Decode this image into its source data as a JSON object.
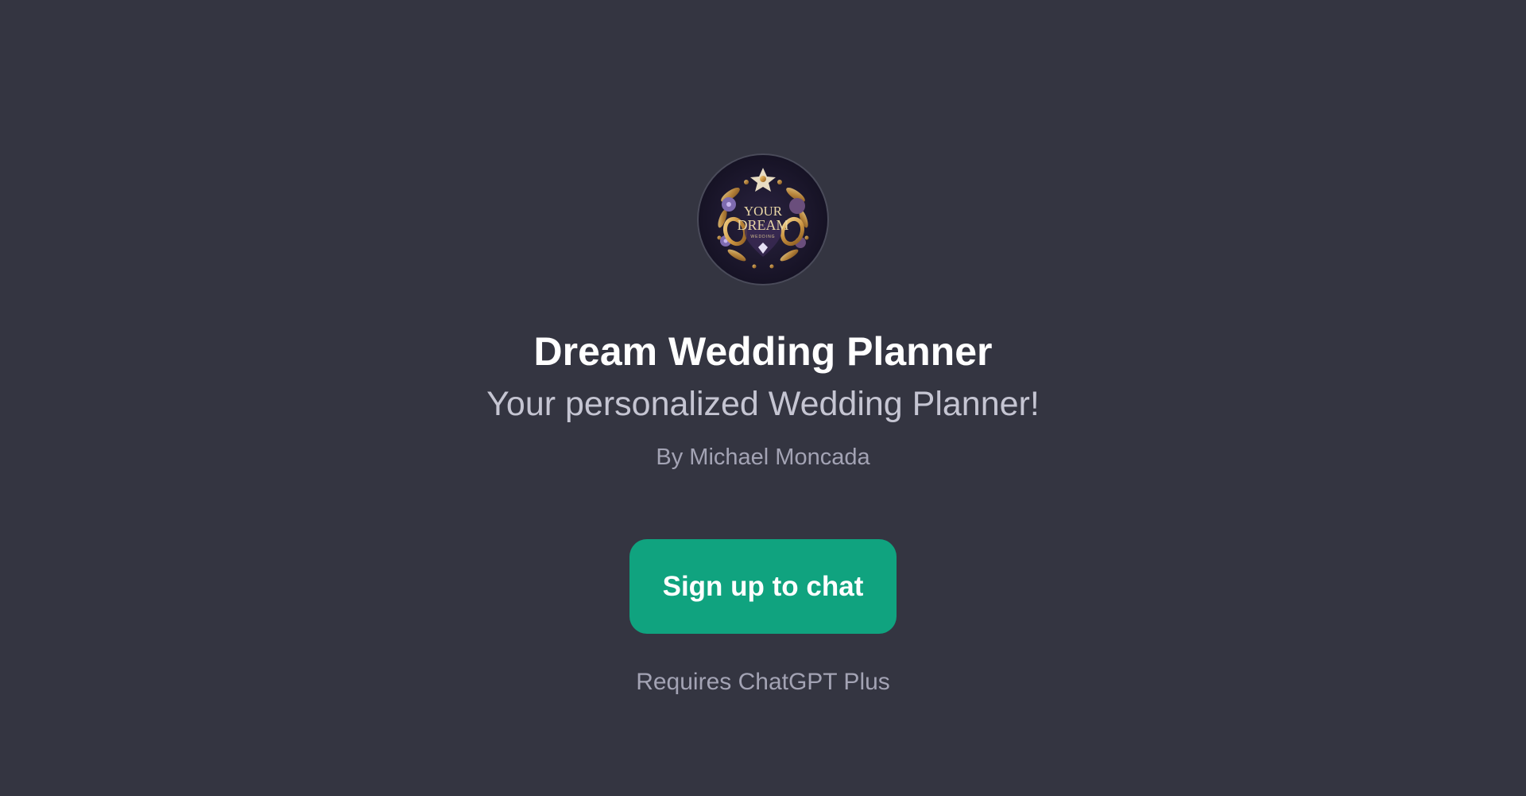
{
  "gpt": {
    "avatar_icon": "wedding-logo-icon",
    "avatar_text_line1": "YOUR",
    "avatar_text_line2": "DREAM",
    "avatar_text_line3": "WEDDING",
    "title": "Dream Wedding Planner",
    "subtitle": "Your personalized Wedding Planner!",
    "author": "By Michael Moncada",
    "cta_label": "Sign up to chat",
    "requirement": "Requires ChatGPT Plus"
  },
  "colors": {
    "background": "#343541",
    "accent": "#10a37f",
    "title": "#ffffff",
    "subtitle": "#c5c5d2",
    "muted": "#a3a3b4"
  }
}
